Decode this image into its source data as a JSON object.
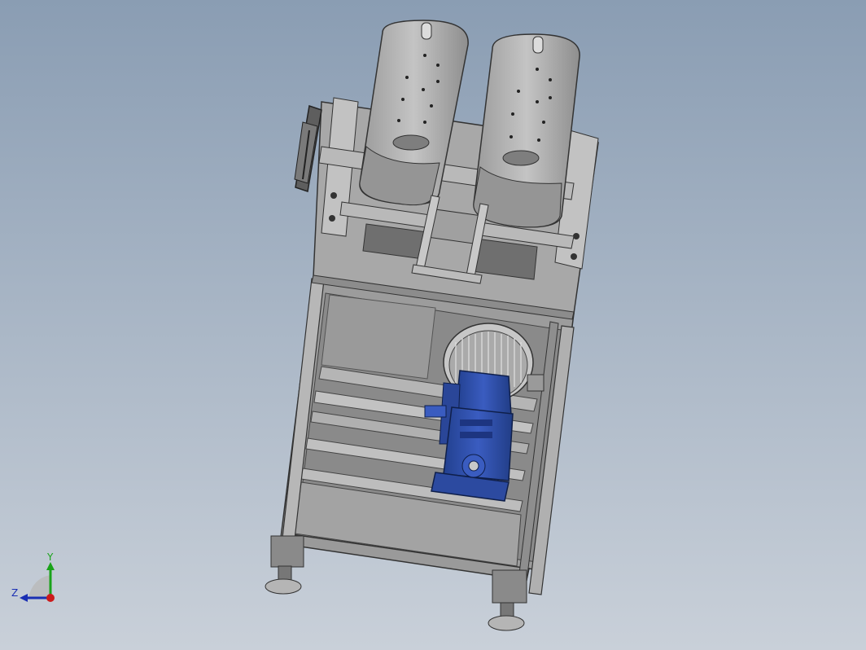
{
  "viewport": {
    "background_top": "#8a9db3",
    "background_bottom": "#c9d0d9"
  },
  "model": {
    "frame_color": "#8c8c8c",
    "panel_color": "#a6a6a6",
    "motor_color": "#2f4fa8",
    "tank_color": "#b3b3b3"
  },
  "triad": {
    "y_label": "Y",
    "z_label": "Z",
    "y_color": "#1aa31a",
    "z_color": "#1a2fb3",
    "x_color": "#cc1a1a"
  }
}
